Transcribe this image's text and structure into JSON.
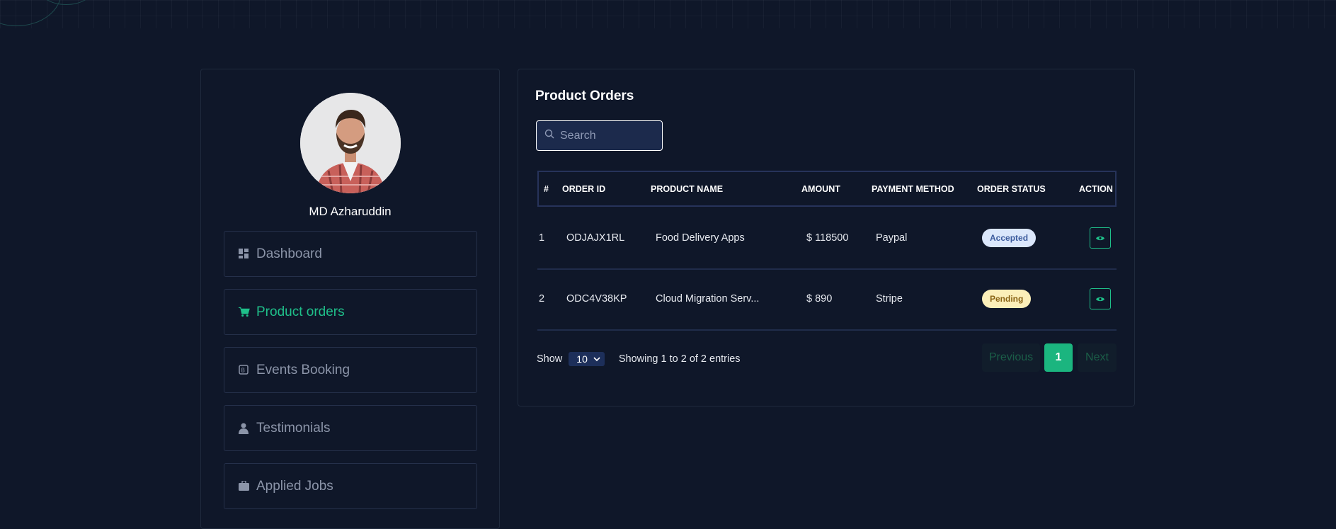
{
  "profile": {
    "name": "MD Azharuddin"
  },
  "sidebar": {
    "items": [
      {
        "label": "Dashboard",
        "icon": "dashboard-icon"
      },
      {
        "label": "Product orders",
        "icon": "cart-icon",
        "active": true
      },
      {
        "label": "Events Booking",
        "icon": "booking-icon"
      },
      {
        "label": "Testimonials",
        "icon": "user-icon"
      },
      {
        "label": "Applied Jobs",
        "icon": "briefcase-icon"
      }
    ]
  },
  "orders": {
    "title": "Product Orders",
    "search_placeholder": "Search",
    "columns": [
      "#",
      "ORDER ID",
      "PRODUCT NAME",
      "AMOUNT",
      "PAYMENT METHOD",
      "ORDER STATUS",
      "ACTION"
    ],
    "rows": [
      {
        "index": "1",
        "order_id": "ODJAJX1RL",
        "product": "Food Delivery Apps",
        "amount": "$ 118500",
        "payment": "Paypal",
        "status": "Accepted"
      },
      {
        "index": "2",
        "order_id": "ODC4V38KP",
        "product": "Cloud Migration Serv...",
        "amount": "$ 890",
        "payment": "Stripe",
        "status": "Pending"
      }
    ],
    "show_label": "Show",
    "page_size": "10",
    "entries_text": "Showing 1 to 2 of 2 entries",
    "pagination": {
      "previous": "Previous",
      "current": "1",
      "next": "Next"
    }
  },
  "colors": {
    "background": "#0f1729",
    "accent": "#1bb57f",
    "accepted_bg": "#dbe7fb",
    "pending_bg": "#fbefb9"
  }
}
